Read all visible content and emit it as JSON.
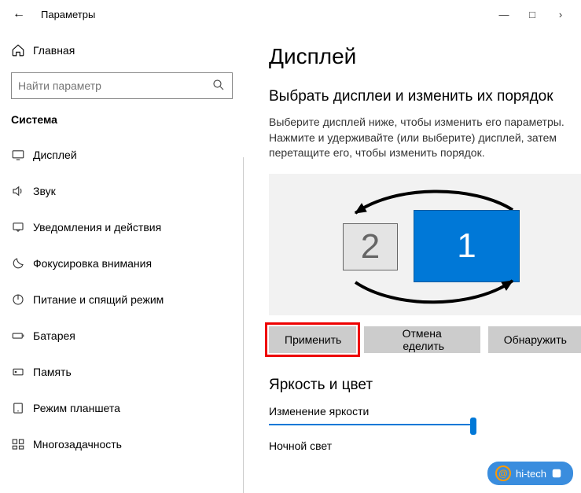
{
  "titlebar": {
    "back_glyph": "←",
    "title": "Параметры",
    "min": "—",
    "max": "□",
    "next": "›"
  },
  "sidebar": {
    "home_label": "Главная",
    "search_placeholder": "Найти параметр",
    "category_label": "Система",
    "items": [
      {
        "label": "Дисплей"
      },
      {
        "label": "Звук"
      },
      {
        "label": "Уведомления и действия"
      },
      {
        "label": "Фокусировка внимания"
      },
      {
        "label": "Питание и спящий режим"
      },
      {
        "label": "Батарея"
      },
      {
        "label": "Память"
      },
      {
        "label": "Режим планшета"
      },
      {
        "label": "Многозадачность"
      }
    ]
  },
  "content": {
    "h1": "Дисплей",
    "h2": "Выбрать дисплеи и изменить их порядок",
    "desc": "Выберите дисплей ниже, чтобы изменить его параметры. Нажмите и удерживайте (или выберите) дисплей, затем перетащите его, чтобы изменить порядок.",
    "monitor1": "1",
    "monitor2": "2",
    "apply": "Применить",
    "cancel": "Отмена",
    "identify_suffix": "еделить",
    "detect": "Обнаружить",
    "h3": "Яркость и цвет",
    "brightness_label": "Изменение яркости",
    "night_label": "Ночной свет"
  },
  "watermark": {
    "text": "hi-tech"
  }
}
